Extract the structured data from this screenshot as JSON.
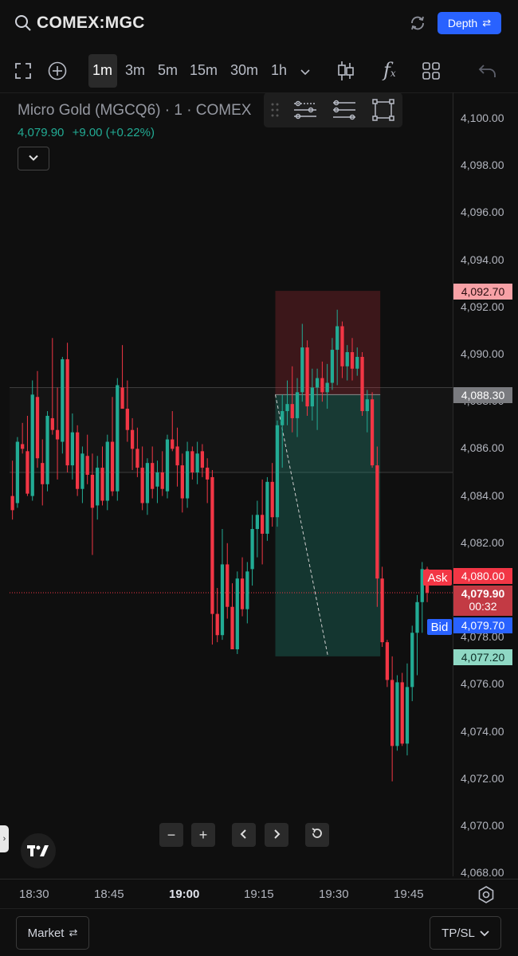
{
  "header": {
    "symbol": "COMEX:MGC",
    "depth_label": "Depth",
    "icons": [
      "search-icon",
      "refresh-icon",
      "swap-icon"
    ]
  },
  "toolbar": {
    "timeframes": [
      "1m",
      "3m",
      "5m",
      "15m",
      "30m",
      "1h"
    ],
    "active_timeframe": "1m",
    "icons": [
      "fullscreen-icon",
      "add-icon",
      "chevron-down-icon",
      "candles-icon",
      "indicator-icon",
      "layout-icon",
      "undo-icon"
    ]
  },
  "legend": {
    "title": "Micro Gold (MGCQ6) · 1 · COMEX",
    "price": "4,079.90",
    "change": "+9.00 (+0.22%)"
  },
  "price_axis": {
    "labels": [
      "4,100.00",
      "4,098.00",
      "4,096.00",
      "4,094.00",
      "4,092.00",
      "4,090.00",
      "4,088.00",
      "4,086.00",
      "4,084.00",
      "4,082.00",
      "4,080.00",
      "4,078.00",
      "4,076.00",
      "4,074.00",
      "4,072.00",
      "4,070.00",
      "4,068.00"
    ],
    "badges": {
      "stop": "4,092.70",
      "entry": "4,088.30",
      "ask_tag": "Ask",
      "ask": "4,080.00",
      "last": "4,079.90",
      "countdown": "00:32",
      "bid_tag": "Bid",
      "bid": "4,079.70",
      "target": "4,077.20"
    }
  },
  "time_axis": {
    "labels": [
      "18:30",
      "18:45",
      "19:00",
      "19:15",
      "19:30",
      "19:45"
    ],
    "bold_label": "19:00"
  },
  "nav_buttons": [
    "minus-icon",
    "plus-icon",
    "chevron-left-icon",
    "chevron-right-icon",
    "reset-icon"
  ],
  "footer": {
    "market_label": "Market",
    "tpsl_label": "TP/SL"
  },
  "colors": {
    "up": "#22ab94",
    "down": "#f23645",
    "accent": "#2962ff",
    "stop_zone": "#f2364533",
    "target_zone": "#22ab9440"
  },
  "chart_data": {
    "type": "candlestick",
    "x_range": [
      "18:26",
      "19:51"
    ],
    "ylim": [
      4067.4,
      4101.0
    ],
    "candles": [
      [
        4084.0,
        4085.5,
        4083.0,
        4083.4
      ],
      [
        4083.7,
        4086.5,
        4083.5,
        4086.3
      ],
      [
        4086.2,
        4087.1,
        4085.8,
        4086.0
      ],
      [
        4085.9,
        4087.4,
        4084.0,
        4084.1
      ],
      [
        4084.0,
        4088.9,
        4083.8,
        4088.3
      ],
      [
        4088.2,
        4089.3,
        4085.2,
        4085.6
      ],
      [
        4085.4,
        4086.4,
        4083.6,
        4084.5
      ],
      [
        4084.5,
        4087.6,
        4084.2,
        4087.4
      ],
      [
        4087.3,
        4090.7,
        4086.6,
        4086.8
      ],
      [
        4086.8,
        4088.6,
        4084.7,
        4086.4
      ],
      [
        4086.3,
        4089.9,
        4085.8,
        4089.8
      ],
      [
        4089.8,
        4090.5,
        4085.0,
        4085.3
      ],
      [
        4085.3,
        4087.5,
        4084.7,
        4086.7
      ],
      [
        4086.7,
        4087.0,
        4084.0,
        4084.3
      ],
      [
        4084.3,
        4086.1,
        4083.7,
        4085.8
      ],
      [
        4085.7,
        4086.6,
        4084.5,
        4084.9
      ],
      [
        4084.9,
        4085.8,
        4081.5,
        4083.5
      ],
      [
        4083.6,
        4085.7,
        4083.0,
        4085.2
      ],
      [
        4085.2,
        4086.1,
        4083.6,
        4083.8
      ],
      [
        4083.8,
        4086.6,
        4083.4,
        4086.3
      ],
      [
        4086.3,
        4088.2,
        4084.0,
        4084.2
      ],
      [
        4084.2,
        4089.0,
        4083.8,
        4088.7
      ],
      [
        4088.6,
        4090.4,
        4087.8,
        4087.7
      ],
      [
        4087.7,
        4088.9,
        4086.3,
        4086.8
      ],
      [
        4086.8,
        4087.3,
        4085.1,
        4086.0
      ],
      [
        4086.0,
        4086.9,
        4084.8,
        4085.2
      ],
      [
        4085.2,
        4086.1,
        4083.4,
        4083.7
      ],
      [
        4083.7,
        4085.6,
        4083.2,
        4085.4
      ],
      [
        4085.4,
        4086.1,
        4083.9,
        4084.3
      ],
      [
        4084.4,
        4085.5,
        4083.7,
        4085.0
      ],
      [
        4085.0,
        4085.9,
        4084.0,
        4084.3
      ],
      [
        4084.2,
        4086.6,
        4083.9,
        4086.4
      ],
      [
        4086.4,
        4087.6,
        4085.9,
        4086.0
      ],
      [
        4086.1,
        4086.9,
        4084.4,
        4085.3
      ],
      [
        4085.3,
        4085.8,
        4083.3,
        4083.9
      ],
      [
        4083.9,
        4086.3,
        4083.5,
        4085.9
      ],
      [
        4085.9,
        4086.1,
        4084.7,
        4085.0
      ],
      [
        4085.0,
        4086.3,
        4084.5,
        4085.8
      ],
      [
        4085.9,
        4086.2,
        4084.8,
        4085.2
      ],
      [
        4085.2,
        4085.6,
        4083.7,
        4084.7
      ],
      [
        4084.8,
        4085.1,
        4077.7,
        4079.0
      ],
      [
        4079.0,
        4080.1,
        4077.8,
        4078.1
      ],
      [
        4078.1,
        4082.6,
        4077.9,
        4081.1
      ],
      [
        4081.1,
        4082.0,
        4078.8,
        4079.3
      ],
      [
        4079.3,
        4080.3,
        4077.5,
        4077.5
      ],
      [
        4077.5,
        4080.8,
        4077.3,
        4080.5
      ],
      [
        4080.5,
        4081.4,
        4078.9,
        4079.2
      ],
      [
        4079.2,
        4081.2,
        4078.6,
        4080.8
      ],
      [
        4080.9,
        4083.2,
        4080.2,
        4082.6
      ],
      [
        4082.6,
        4083.8,
        4081.4,
        4083.2
      ],
      [
        4083.2,
        4084.7,
        4081.1,
        4082.4
      ],
      [
        4082.4,
        4084.8,
        4082.1,
        4084.6
      ],
      [
        4084.6,
        4085.4,
        4082.7,
        4083.1
      ],
      [
        4083.1,
        4087.2,
        4082.7,
        4087.0
      ],
      [
        4087.0,
        4088.3,
        4085.2,
        4087.6
      ],
      [
        4087.6,
        4088.9,
        4087.0,
        4087.9
      ],
      [
        4087.9,
        4089.5,
        4086.7,
        4087.3
      ],
      [
        4087.3,
        4089.0,
        4086.5,
        4088.4
      ],
      [
        4088.4,
        4091.3,
        4088.0,
        4090.3
      ],
      [
        4090.3,
        4090.6,
        4087.4,
        4087.8
      ],
      [
        4087.8,
        4089.4,
        4087.2,
        4088.6
      ],
      [
        4088.6,
        4089.4,
        4086.8,
        4089.0
      ],
      [
        4089.0,
        4089.7,
        4088.0,
        4088.4
      ],
      [
        4088.4,
        4089.6,
        4087.7,
        4088.8
      ],
      [
        4088.8,
        4090.7,
        4088.5,
        4090.2
      ],
      [
        4090.2,
        4091.9,
        4088.7,
        4091.2
      ],
      [
        4091.2,
        4091.4,
        4089.0,
        4089.5
      ],
      [
        4089.5,
        4090.4,
        4088.9,
        4090.1
      ],
      [
        4090.1,
        4090.7,
        4088.9,
        4089.4
      ],
      [
        4089.4,
        4090.3,
        4089.1,
        4089.9
      ],
      [
        4089.9,
        4090.1,
        4087.4,
        4087.6
      ],
      [
        4087.6,
        4088.5,
        4086.7,
        4088.1
      ],
      [
        4088.1,
        4088.4,
        4085.2,
        4085.3
      ],
      [
        4085.3,
        4086.1,
        4079.3,
        4080.5
      ],
      [
        4080.5,
        4081.0,
        4077.6,
        4077.8
      ],
      [
        4077.8,
        4077.9,
        4075.9,
        4076.2
      ],
      [
        4076.2,
        4077.2,
        4071.9,
        4073.4
      ],
      [
        4073.4,
        4076.4,
        4073.2,
        4076.1
      ],
      [
        4076.1,
        4076.5,
        4073.4,
        4073.5
      ],
      [
        4073.5,
        4076.9,
        4073.0,
        4075.9
      ],
      [
        4075.9,
        4078.5,
        4075.3,
        4078.2
      ],
      [
        4078.2,
        4079.8,
        4076.4,
        4079.5
      ],
      [
        4079.5,
        4081.2,
        4078.2,
        4080.9
      ],
      [
        4080.9,
        4081.0,
        4079.5,
        4079.9
      ]
    ],
    "position": {
      "entry": 4088.3,
      "stop": 4092.7,
      "target": 4077.2,
      "start": "19:20",
      "end": "19:41"
    },
    "bands": [
      4088.6,
      4085.0
    ],
    "current_price": 4079.9
  }
}
